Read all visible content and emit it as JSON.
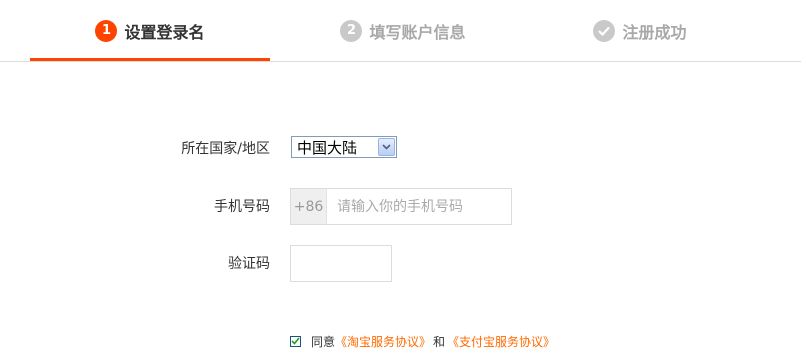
{
  "steps": [
    {
      "number": "1",
      "label": "设置登录名",
      "state": "active"
    },
    {
      "number": "2",
      "label": "填写账户信息",
      "state": "pending"
    },
    {
      "number": "✓",
      "label": "注册成功",
      "state": "pending"
    }
  ],
  "form": {
    "country_label": "所在国家/地区",
    "country_value": "中国大陆",
    "phone_label": "手机号码",
    "phone_prefix": "+86",
    "phone_placeholder": "请输入你的手机号码",
    "code_label": "验证码",
    "code_value": ""
  },
  "agreement": {
    "checked": true,
    "prefix": "同意",
    "link1": "《淘宝服务协议》",
    "conjunction": "和",
    "link2": "《支付宝服务协议》"
  },
  "colors": {
    "accent": "#ff4400",
    "link": "#ff6a00",
    "inactive": "#c9c9c9"
  }
}
